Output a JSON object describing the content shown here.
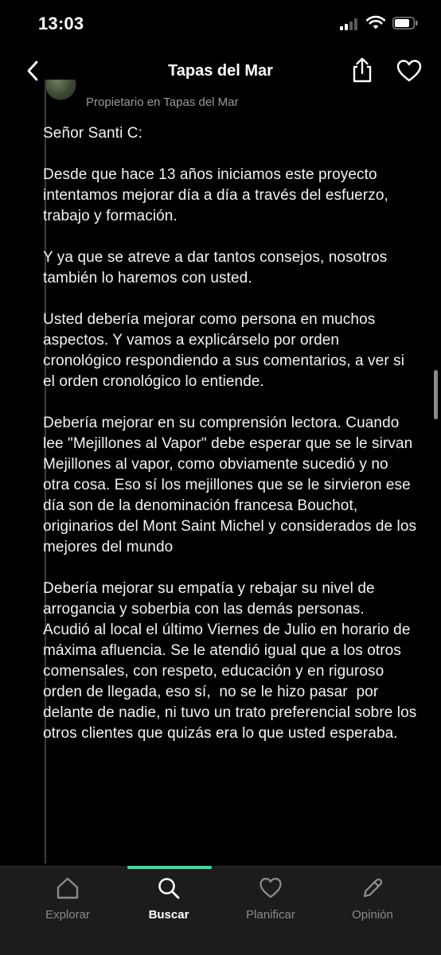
{
  "status_bar": {
    "time": "13:03"
  },
  "header": {
    "title": "Tapas del Mar",
    "back_icon": "chevron-left-icon",
    "share_icon": "share-icon",
    "favorite_icon": "heart-icon"
  },
  "reply": {
    "author_role": "Propietario en Tapas del Mar",
    "text": "Señor Santi C:\n\nDesde que hace 13 años iniciamos este proyecto intentamos mejorar día a día a través del esfuerzo, trabajo y formación.\n\nY ya que se atreve a dar tantos consejos, nosotros también lo haremos con usted.\n\nUsted debería mejorar como persona en muchos aspectos. Y vamos a explicárselo por orden cronológico respondiendo a sus comentarios, a ver si el orden cronológico lo entiende.\n\nDebería mejorar en su comprensión lectora. Cuando lee \"Mejillones al Vapor\" debe esperar que se le sirvan Mejillones al vapor, como obviamente sucedió y no otra cosa. Eso sí los mejillones que se le sirvieron ese día son de la denominación francesa Bouchot, originarios del Mont Saint Michel y considerados de los mejores del mundo\n\nDebería mejorar su empatía y rebajar su nivel de arrogancia y soberbia con las demás personas.\nAcudió al local el último Viernes de Julio en horario de máxima afluencia. Se le atendió igual que a los otros comensales, con respeto, educación y en riguroso orden de llegada, eso sí,  no se le hizo pasar  por delante de nadie, ni tuvo un trato preferencial sobre los otros clientes que quizás era lo que usted esperaba."
  },
  "tab_bar": {
    "active_tab": "Buscar",
    "accent_color": "#34e0a1",
    "tabs": [
      {
        "label": "Explorar",
        "icon": "home-icon"
      },
      {
        "label": "Buscar",
        "icon": "search-icon"
      },
      {
        "label": "Planificar",
        "icon": "heart-icon"
      },
      {
        "label": "Opinión",
        "icon": "pencil-icon"
      }
    ]
  }
}
